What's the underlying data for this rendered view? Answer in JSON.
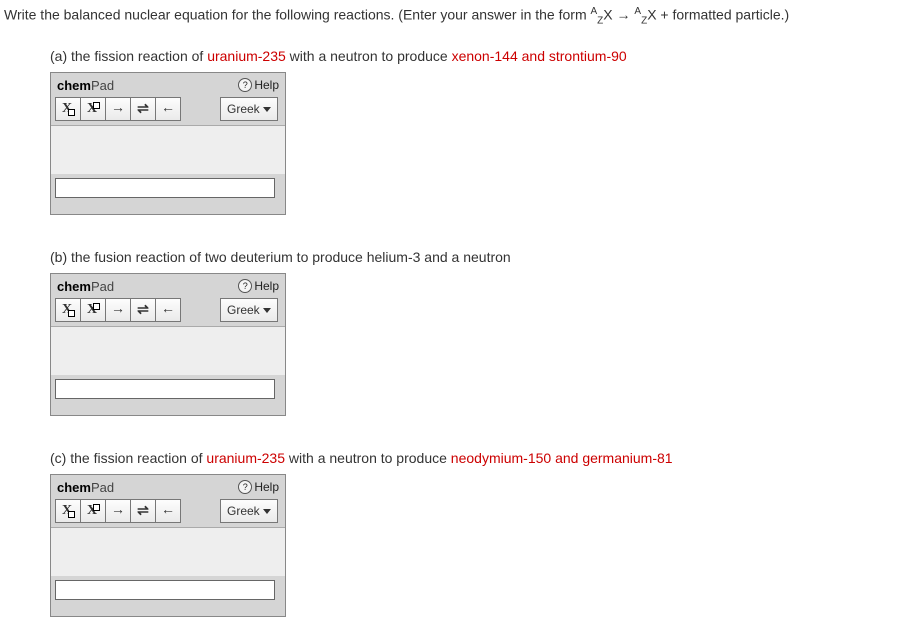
{
  "instruction": {
    "prefix": "Write the balanced nuclear equation for the following reactions. (Enter your answer in the form ",
    "suffix": " + formatted particle.)"
  },
  "equation_notation": {
    "A": "A",
    "Z": "Z",
    "X": "X",
    "arrow": "→"
  },
  "parts": [
    {
      "label": "(a) the fission reaction of ",
      "reactant": "uranium-235",
      "middle": " with a neutron to produce ",
      "products": "xenon-144 and strontium-90"
    },
    {
      "label": "(b) the fusion reaction of two deuterium to produce helium-3 and a neutron",
      "reactant": "",
      "middle": "",
      "products": ""
    },
    {
      "label": "(c) the fission reaction of ",
      "reactant": "uranium-235",
      "middle": " with a neutron to produce ",
      "products": "neodymium-150 and germanium-81"
    }
  ],
  "chempad": {
    "brand_chem": "chem",
    "brand_pad": "Pad",
    "help_label": "Help",
    "greek_label": "Greek",
    "input_value": ""
  },
  "toolbar_icons": {
    "sub": "X",
    "sup": "X",
    "right_arrow": "→",
    "equil": "⇌",
    "left_arrow": "←"
  }
}
